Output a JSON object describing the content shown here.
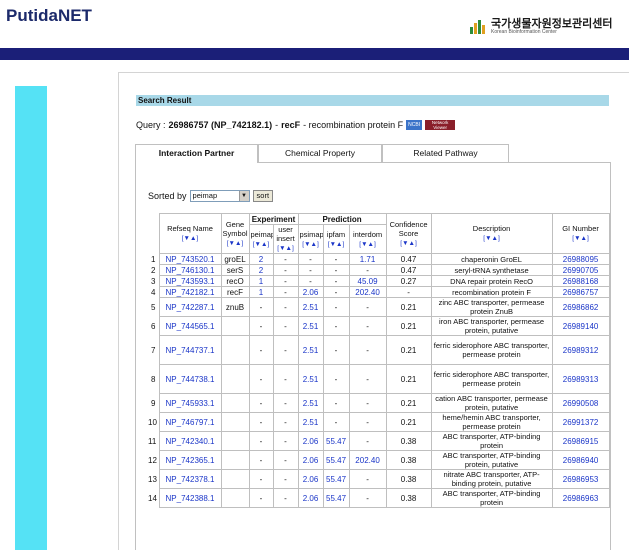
{
  "header": {
    "logo": "PutidaNET",
    "partner_logo_main": "국가생물자원정보관리센터",
    "partner_logo_sub": "Korean Bioinformation Center"
  },
  "search": {
    "section_title": "Search Result",
    "query_label": "Query :",
    "query_id": "26986757 (NP_742182.1)",
    "query_sep": "-",
    "query_gene": "recF",
    "query_desc": "- recombination protein F",
    "ncbi_badge": "NCBI",
    "network_badge_top": "Network",
    "network_badge_bottom": "Viewer"
  },
  "tabs": [
    {
      "label": "Interaction Partner",
      "active": true
    },
    {
      "label": "Chemical Property",
      "active": false
    },
    {
      "label": "Related Pathway",
      "active": false
    }
  ],
  "sort": {
    "label": "Sorted by",
    "value": "peimap",
    "button": "sort"
  },
  "table": {
    "group_experiment": "Experiment",
    "group_prediction": "Prediction",
    "sort_marker": "[▼▲]",
    "columns": {
      "refseq": "Refseq Name",
      "gene_symbol": "Gene Symbol",
      "peimap": "peimap",
      "user_insert": "user insert",
      "psimap": "psimap",
      "ipfam": "ipfam",
      "interdom": "interdom",
      "confidence": "Confidence Score",
      "description": "Description",
      "gi": "GI Number"
    },
    "rows": [
      {
        "n": "1",
        "refseq": "NP_743520.1",
        "sym": "groEL",
        "peimap": "2",
        "user": "-",
        "psimap": "-",
        "ipfam": "-",
        "interdom": "1.71",
        "score": "0.47",
        "desc": "chaperonin GroEL",
        "gi": "26988095"
      },
      {
        "n": "2",
        "refseq": "NP_746130.1",
        "sym": "serS",
        "peimap": "2",
        "user": "-",
        "psimap": "-",
        "ipfam": "-",
        "interdom": "-",
        "score": "0.47",
        "desc": "seryl-tRNA synthetase",
        "gi": "26990705"
      },
      {
        "n": "3",
        "refseq": "NP_743593.1",
        "sym": "recO",
        "peimap": "1",
        "user": "-",
        "psimap": "-",
        "ipfam": "-",
        "interdom": "45.09",
        "score": "0.27",
        "desc": "DNA repair protein RecO",
        "gi": "26988168"
      },
      {
        "n": "4",
        "refseq": "NP_742182.1",
        "sym": "recF",
        "peimap": "1",
        "user": "-",
        "psimap": "2.06",
        "ipfam": "-",
        "interdom": "202.40",
        "score": "-",
        "desc": "recombination protein F",
        "gi": "26986757"
      },
      {
        "n": "5",
        "refseq": "NP_742287.1",
        "sym": "znuB",
        "peimap": "-",
        "user": "-",
        "psimap": "2.51",
        "ipfam": "-",
        "interdom": "-",
        "score": "0.21",
        "desc": "zinc ABC transporter, permease protein ZnuB",
        "gi": "26986862"
      },
      {
        "n": "6",
        "refseq": "NP_744565.1",
        "sym": "",
        "peimap": "-",
        "user": "-",
        "psimap": "2.51",
        "ipfam": "-",
        "interdom": "-",
        "score": "0.21",
        "desc": "iron ABC transporter, permease protein, putative",
        "gi": "26989140"
      },
      {
        "n": "7",
        "refseq": "NP_744737.1",
        "sym": "",
        "peimap": "-",
        "user": "-",
        "psimap": "2.51",
        "ipfam": "-",
        "interdom": "-",
        "score": "0.21",
        "desc": "ferric siderophore ABC transporter, permease protein",
        "gi": "26989312"
      },
      {
        "n": "8",
        "refseq": "NP_744738.1",
        "sym": "",
        "peimap": "-",
        "user": "-",
        "psimap": "2.51",
        "ipfam": "-",
        "interdom": "-",
        "score": "0.21",
        "desc": "ferric siderophore ABC transporter, permease protein",
        "gi": "26989313"
      },
      {
        "n": "9",
        "refseq": "NP_745933.1",
        "sym": "",
        "peimap": "-",
        "user": "-",
        "psimap": "2.51",
        "ipfam": "-",
        "interdom": "-",
        "score": "0.21",
        "desc": "cation ABC transporter, permease protein, putative",
        "gi": "26990508"
      },
      {
        "n": "10",
        "refseq": "NP_746797.1",
        "sym": "",
        "peimap": "-",
        "user": "-",
        "psimap": "2.51",
        "ipfam": "-",
        "interdom": "-",
        "score": "0.21",
        "desc": "heme/hemin ABC transporter, permease protein",
        "gi": "26991372"
      },
      {
        "n": "11",
        "refseq": "NP_742340.1",
        "sym": "",
        "peimap": "-",
        "user": "-",
        "psimap": "2.06",
        "ipfam": "55.47",
        "interdom": "-",
        "score": "0.38",
        "desc": "ABC transporter, ATP-binding protein",
        "gi": "26986915"
      },
      {
        "n": "12",
        "refseq": "NP_742365.1",
        "sym": "",
        "peimap": "-",
        "user": "-",
        "psimap": "2.06",
        "ipfam": "55.47",
        "interdom": "202.40",
        "score": "0.38",
        "desc": "ABC transporter, ATP-binding protein, putative",
        "gi": "26986940"
      },
      {
        "n": "13",
        "refseq": "NP_742378.1",
        "sym": "",
        "peimap": "-",
        "user": "-",
        "psimap": "2.06",
        "ipfam": "55.47",
        "interdom": "-",
        "score": "0.38",
        "desc": "nitrate ABC transporter, ATP-binding protein, putative",
        "gi": "26986953"
      },
      {
        "n": "14",
        "refseq": "NP_742388.1",
        "sym": "",
        "peimap": "-",
        "user": "-",
        "psimap": "2.06",
        "ipfam": "55.47",
        "interdom": "-",
        "score": "0.38",
        "desc": "ABC transporter, ATP-binding protein",
        "gi": "26986963"
      }
    ]
  },
  "colors": {
    "nav_bar": "#1b1f78",
    "side_bar": "#55e2f5",
    "section_bar": "#a8d8e8",
    "link": "#1a35c8"
  }
}
